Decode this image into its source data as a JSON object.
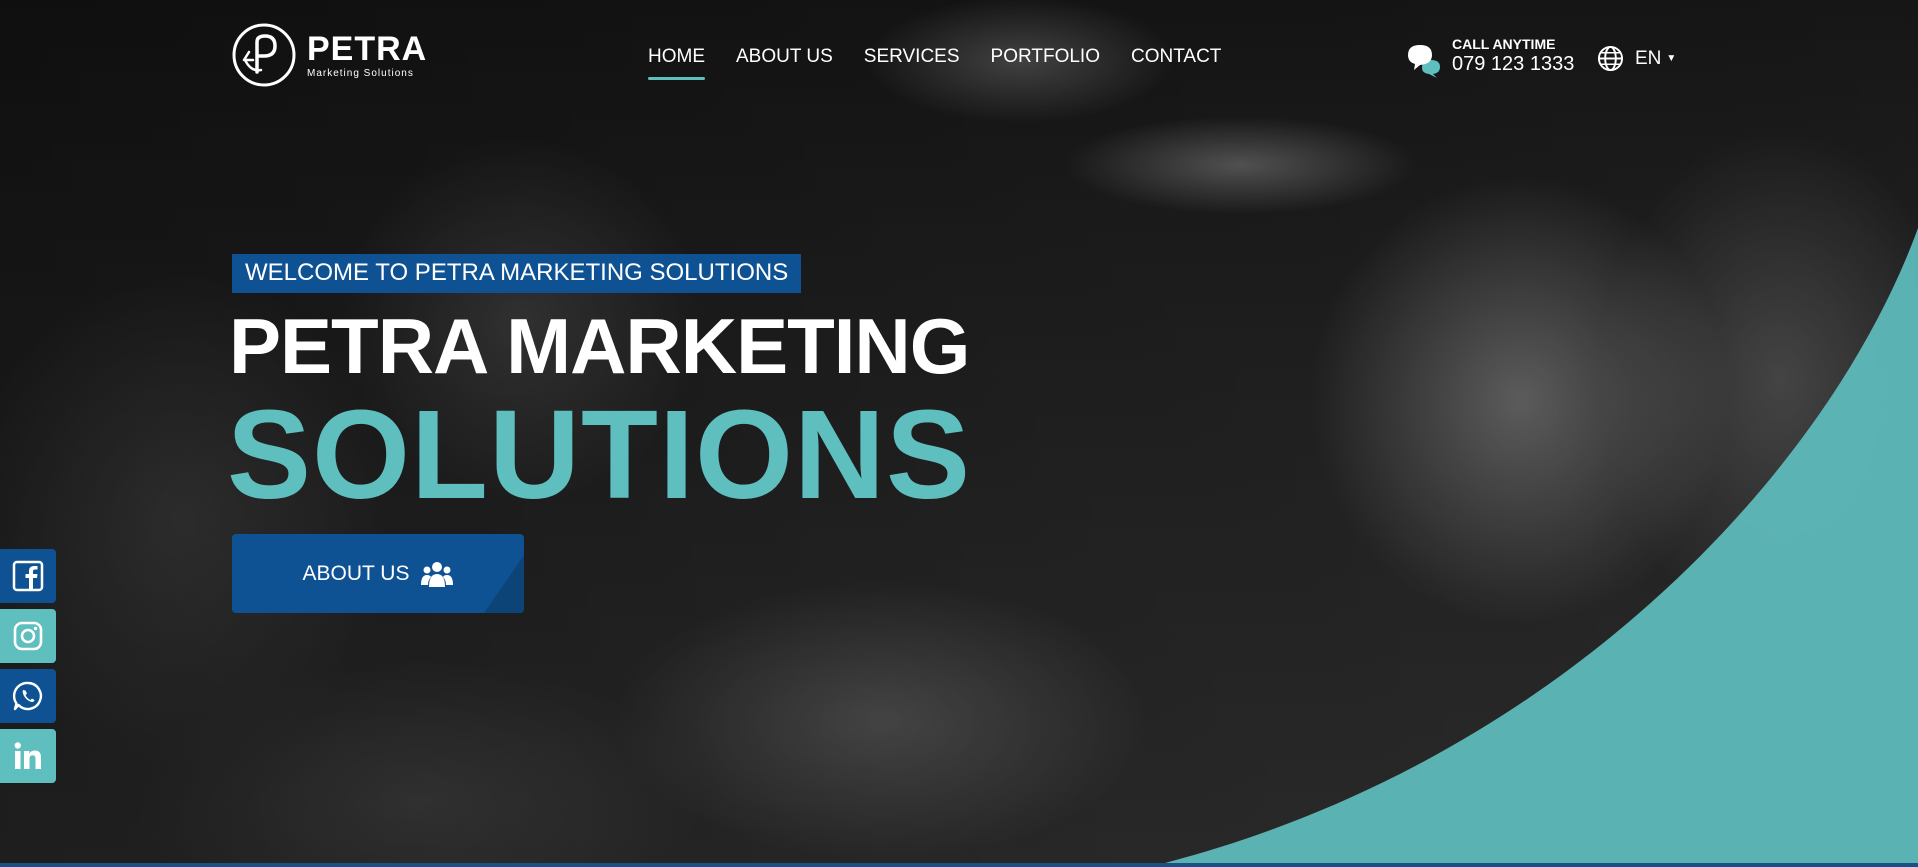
{
  "brand": {
    "name": "PETRA",
    "tagline": "Marketing Solutions"
  },
  "nav": {
    "items": [
      {
        "label": "HOME",
        "active": true
      },
      {
        "label": "ABOUT US",
        "active": false
      },
      {
        "label": "SERVICES",
        "active": false
      },
      {
        "label": "PORTFOLIO",
        "active": false
      },
      {
        "label": "CONTACT",
        "active": false
      }
    ]
  },
  "contact": {
    "label": "CALL ANYTIME",
    "phone": "079 123 1333",
    "icon": "chat-bubbles-icon"
  },
  "language": {
    "current": "EN",
    "icon": "globe-icon"
  },
  "hero": {
    "welcome": "WELCOME TO PETRA MARKETING SOLUTIONS",
    "title": "PETRA MARKETING",
    "title_accent": "SOLUTIONS",
    "cta_label": "ABOUT US",
    "cta_icon": "users-group-icon"
  },
  "social": [
    {
      "name": "facebook",
      "icon": "facebook-icon",
      "color": "#0f5294"
    },
    {
      "name": "instagram",
      "icon": "instagram-icon",
      "color": "#5fbebe"
    },
    {
      "name": "whatsapp",
      "icon": "whatsapp-icon",
      "color": "#0f5294"
    },
    {
      "name": "linkedin",
      "icon": "linkedin-icon",
      "color": "#5fbebe"
    }
  ],
  "colors": {
    "primary_blue": "#0f5294",
    "accent_teal": "#5fbebe",
    "text_white": "#ffffff"
  }
}
